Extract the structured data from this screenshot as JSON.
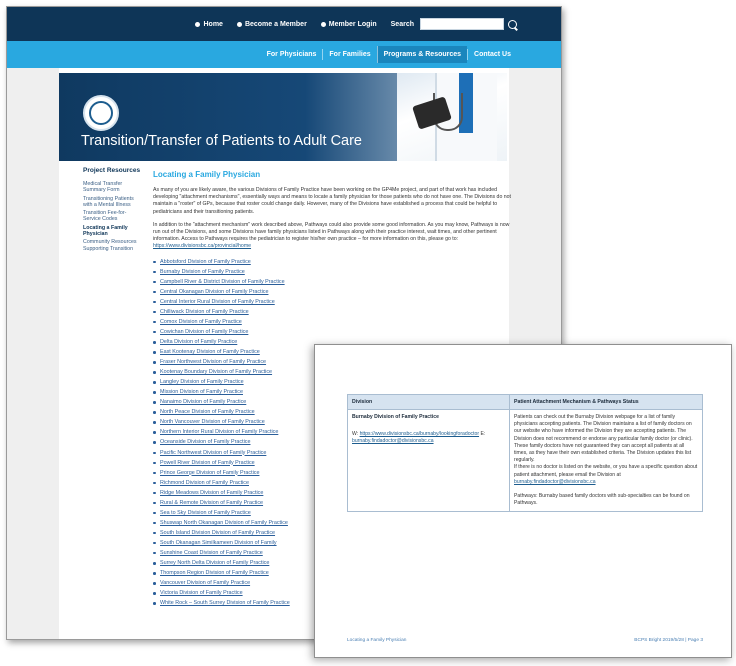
{
  "header": {
    "links": [
      {
        "label": "Home"
      },
      {
        "label": "Become a Member"
      },
      {
        "label": "Member Login"
      }
    ],
    "search_label": "Search"
  },
  "nav": {
    "items": [
      "For Physicians",
      "For Families",
      "Programs & Resources",
      "Contact Us"
    ],
    "active_index": 2
  },
  "banner": {
    "title": "Transition/Transfer of Patients to Adult Care"
  },
  "sidebar": {
    "heading": "Project Resources",
    "items": [
      "Medical Transfer Summary Form",
      "Transitioning Patients with a Mental Illness",
      "Transition Fee-for-Service Codes",
      "Locating a Family Physician",
      "Community Resources Supporting Transition"
    ],
    "active_index": 3
  },
  "main": {
    "heading": "Locating a Family Physician",
    "para1": "As many of you are likely aware, the various Divisions of Family Practice have been working on the GP4Me project, and part of that work has included developing \"attachment mechanisms\", essentially ways and means to locate a family physician for those patients who do not have one. The Divisions do not maintain a \"roster\" of GPs, because that roster could change daily. However, many of the Divisions have established a process that could be helpful to pediatricians and their transitioning patients.",
    "para2": "In addition to the \"attachment mechanism\" work described above, Pathways could also provide some good information. As you may know, Pathways is now run out of the Divisions, and some Divisions have family physicians listed in Pathways along with their practice interest, wait times, and other pertinent information. Access to Pathways requires the pediatrician to register his/her own practice – for more information on this, please go to:",
    "para2_link": "https://www.divisionsbc.ca/provincial/home",
    "divisions": [
      "Abbotsford Division of Family Practice",
      "Burnaby Division of Family Practice",
      "Campbell River & District Division of Family Practice",
      "Central Okanagan Division of Family Practice",
      "Central Interior Rural Division of Family Practice",
      "Chilliwack Division of Family Practice",
      "Comox Division of Family Practice",
      "Cowichan Division of Family Practice",
      "Delta Division of Family Practice",
      "East Kootenay Division of Family Practice",
      "Fraser Northwest Division of Family Practice",
      "Kootenay Boundary Division of Family Practice",
      "Langley Division of Family Practice",
      "Mission Division of Family Practice",
      "Nanaimo Division of Family Practice",
      "North Peace Division of Family Practice",
      "North Vancouver Division of Family Practice",
      "Northern Interior Rural Division of Family Practice",
      "Oceanside Division of Family Practice",
      "Pacific Northwest Division of Family Practice",
      "Powell River Division of Family Practice",
      "Prince George Division of Family Practice",
      "Richmond Division of Family Practice",
      "Ridge Meadows Division of Family Practice",
      "Rural & Remote Division of Family Practice",
      "Sea to Sky Division of Family Practice",
      "Shuswap North Okanagan Division of Family Practice",
      "South Island Division Division of Family Practice",
      "South Okanagan Similkameen Division of Family",
      "Sunshine Coast Division of Family Practice",
      "Surrey North Delta Division of Family Practice",
      "Thompson Region Division of Family Practice",
      "Vancouver Division of Family Practice",
      "Victoria Division of Family Practice",
      "White Rock – South Surrey Division of Family Practice"
    ]
  },
  "document": {
    "col1_header": "Division",
    "col2_header": "Patient Attachment Mechanism & Pathways Status",
    "row_division": "Burnaby Division of Family Practice",
    "row_web_prefix": "W:",
    "row_web_link": "https://www.divisionsbc.ca/burnaby/lookingforadoctor",
    "row_email_prefix": "E:",
    "row_email_link": "burnaby.findadoctor@divisionsbc.ca",
    "status_text": "Patients can check out the Burnaby Division webpage for a list of family physicians accepting patients. The Division maintains a list of family doctors on our website who have informed the Division they are accepting patients. The Division does not recommend or endorse any particular family doctor (or clinic). These family doctors have not guaranteed they can accept all patients at all times, as they have their own established criteria. The Division updates this list regularly.",
    "status_contact": "If there is no doctor is listed on the website, or you have a specific question about patient attachment, please email the Division at",
    "status_email": "burnaby.findadoctor@divisionsbc.ca",
    "status_pathways": "Pathways: Burnaby based family doctors with sub-specialties can be found on Pathways.",
    "footer_left": "Locating a Family Physician",
    "footer_right": "BCPS Bright 2019/5/28 | Page 3"
  }
}
